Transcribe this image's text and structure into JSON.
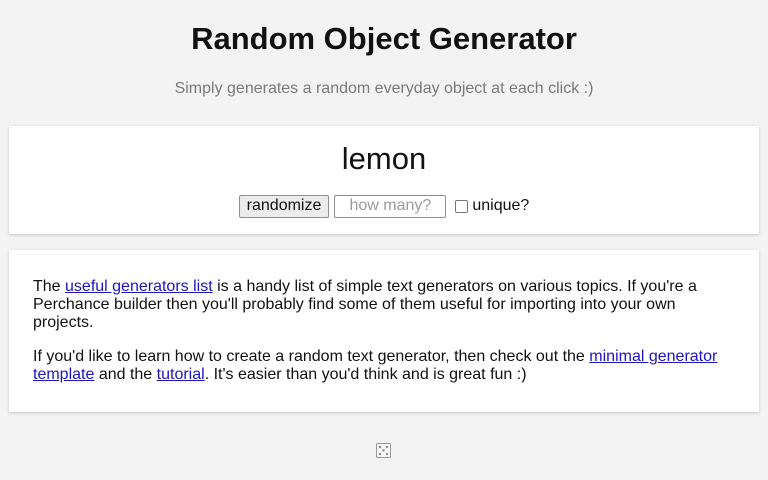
{
  "header": {
    "title": "Random Object Generator",
    "subtitle": "Simply generates a random everyday object at each click :)"
  },
  "generator": {
    "result": "lemon",
    "randomize_label": "randomize",
    "how_many_placeholder": "how many?",
    "how_many_value": "",
    "unique_label": "unique?",
    "unique_checked": false
  },
  "info": {
    "p1_prefix": "The ",
    "p1_link": "useful generators list",
    "p1_suffix": " is a handy list of simple text generators on various topics. If you're a Perchance builder then you'll probably find some of them useful for importing into your own projects.",
    "p2_prefix": "If you'd like to learn how to create a random text generator, then check out the ",
    "p2_link1": "minimal generator template",
    "p2_mid": " and the ",
    "p2_link2": "tutorial",
    "p2_suffix": ". It's easier than you'd think and is great fun :)"
  },
  "footer": {
    "icon": "dice-icon"
  },
  "colors": {
    "background": "#f3f3f3",
    "card": "#ffffff",
    "link": "#1d14c4",
    "subtitle": "#7a7a7a"
  }
}
